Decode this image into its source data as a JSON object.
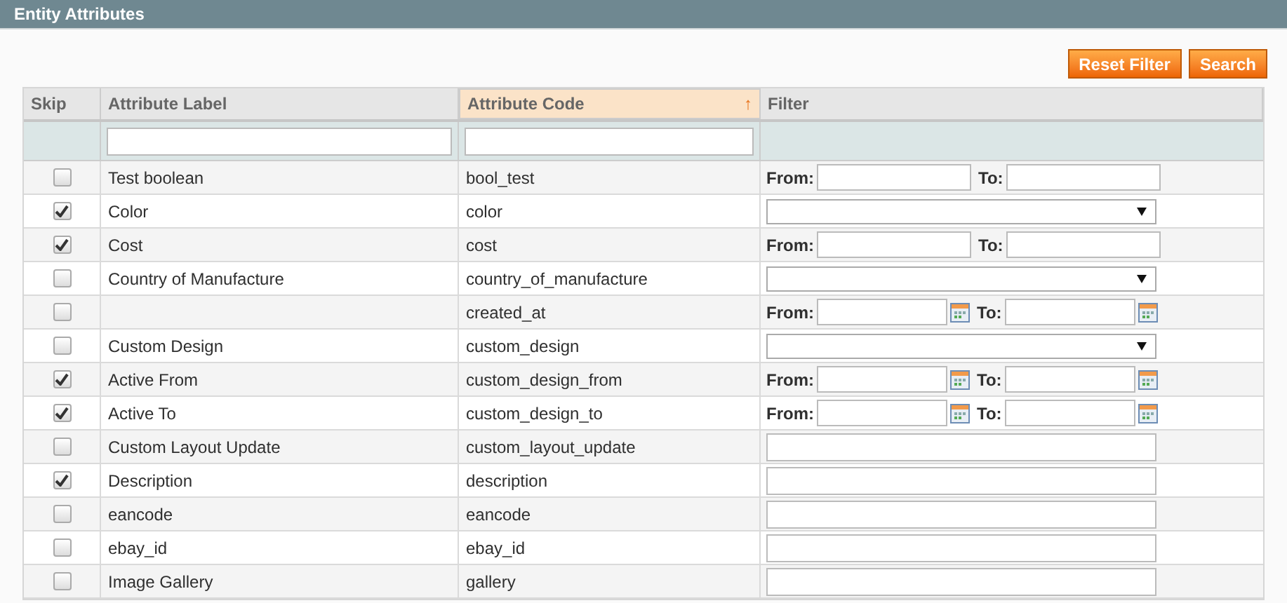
{
  "panel": {
    "title": "Entity Attributes"
  },
  "buttons": [
    "Reset Filter",
    "Search"
  ],
  "table": {
    "columns": [
      {
        "label": "Skip",
        "sorted": false
      },
      {
        "label": "Attribute Label",
        "sorted": false
      },
      {
        "label": "Attribute Code",
        "sorted": true,
        "sort_mark": "↑"
      },
      {
        "label": "Filter",
        "sorted": false
      }
    ],
    "rows": [
      {
        "skip": false,
        "label": "Test boolean",
        "code": "bool_test",
        "filter": {
          "kind": "range",
          "from": "From:",
          "to": "To:"
        }
      },
      {
        "skip": true,
        "label": "Color",
        "code": "color",
        "filter": {
          "kind": "select"
        }
      },
      {
        "skip": true,
        "label": "Cost",
        "code": "cost",
        "filter": {
          "kind": "range",
          "from": "From:",
          "to": "To:"
        }
      },
      {
        "skip": false,
        "label": "Country of Manufacture",
        "code": "country_of_manufacture",
        "filter": {
          "kind": "select"
        }
      },
      {
        "skip": false,
        "label": "",
        "code": "created_at",
        "filter": {
          "kind": "date_range",
          "from": "From:",
          "to": "To:"
        }
      },
      {
        "skip": false,
        "label": "Custom Design",
        "code": "custom_design",
        "filter": {
          "kind": "select"
        }
      },
      {
        "skip": true,
        "label": "Active From",
        "code": "custom_design_from",
        "filter": {
          "kind": "date_range",
          "from": "From:",
          "to": "To:"
        }
      },
      {
        "skip": true,
        "label": "Active To",
        "code": "custom_design_to",
        "filter": {
          "kind": "date_range",
          "from": "From:",
          "to": "To:"
        }
      },
      {
        "skip": false,
        "label": "Custom Layout Update",
        "code": "custom_layout_update",
        "filter": {
          "kind": "text"
        }
      },
      {
        "skip": true,
        "label": "Description",
        "code": "description",
        "filter": {
          "kind": "text"
        }
      },
      {
        "skip": false,
        "label": "eancode",
        "code": "eancode",
        "filter": {
          "kind": "text"
        }
      },
      {
        "skip": false,
        "label": "ebay_id",
        "code": "ebay_id",
        "filter": {
          "kind": "text"
        }
      },
      {
        "skip": false,
        "label": "Image Gallery",
        "code": "gallery",
        "filter": {
          "kind": "text"
        }
      }
    ]
  }
}
